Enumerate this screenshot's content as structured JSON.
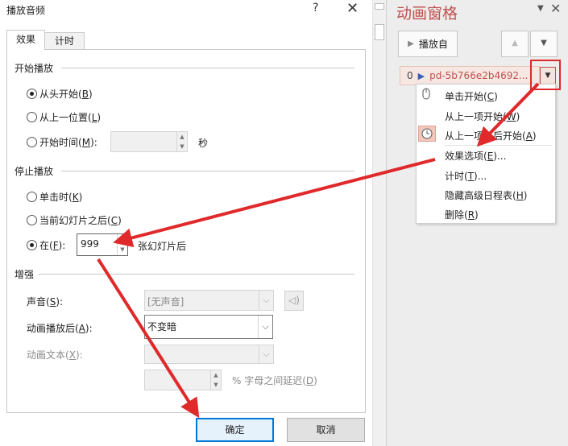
{
  "dialog": {
    "title": "播放音频",
    "help_glyph": "?",
    "close_glyph": "✕",
    "tabs": [
      {
        "label": "效果",
        "selected": true
      },
      {
        "label": "计时",
        "selected": false
      }
    ],
    "start": {
      "group_label": "开始播放",
      "options": [
        {
          "label": "从头开始",
          "key": "B",
          "checked": true
        },
        {
          "label": "从上一位置",
          "key": "L",
          "checked": false
        },
        {
          "label": "开始时间",
          "key": "M",
          "checked": false
        }
      ],
      "start_time_value": "",
      "seconds_unit": "秒"
    },
    "stop": {
      "group_label": "停止播放",
      "options": [
        {
          "label": "单击时",
          "key": "K",
          "checked": false
        },
        {
          "label": "当前幻灯片之后",
          "key": "C",
          "checked": false
        },
        {
          "label": "在",
          "key": "F",
          "checked": true
        }
      ],
      "slides_value": "999",
      "slides_suffix": "张幻灯片后"
    },
    "enhance": {
      "group_label": "增强",
      "sound": {
        "label": "声音",
        "key": "S",
        "value": "[无声音]"
      },
      "after_anim": {
        "label": "动画播放后",
        "key": "A",
        "value": "不变暗"
      },
      "anim_text": {
        "label": "动画文本",
        "key": "X",
        "value": ""
      },
      "delay": {
        "value": "",
        "label": "% 字母之间延迟",
        "key": "D"
      }
    },
    "buttons": {
      "ok": "确定",
      "cancel": "取消"
    }
  },
  "pane": {
    "title": "动画窗格",
    "play_button": "播放自",
    "item": {
      "index": "0",
      "name": "pd-5b766e2b4692..."
    },
    "menu": [
      {
        "label": "单击开始",
        "key": "C",
        "icon": "mouse-icon"
      },
      {
        "label": "从上一项开始",
        "key": "W",
        "icon": ""
      },
      {
        "label": "从上一项之后开始",
        "key": "A",
        "icon": "clock-icon"
      },
      {
        "label": "效果选项",
        "key": "E",
        "suffix": "..."
      },
      {
        "label": "计时",
        "key": "T",
        "suffix": "..."
      },
      {
        "label": "隐藏高级日程表",
        "key": "H"
      },
      {
        "label": "删除",
        "key": "R"
      }
    ]
  },
  "colors": {
    "accent_red": "#e0292a",
    "pane_title": "#c0504d",
    "ok_border": "#0078d7"
  }
}
